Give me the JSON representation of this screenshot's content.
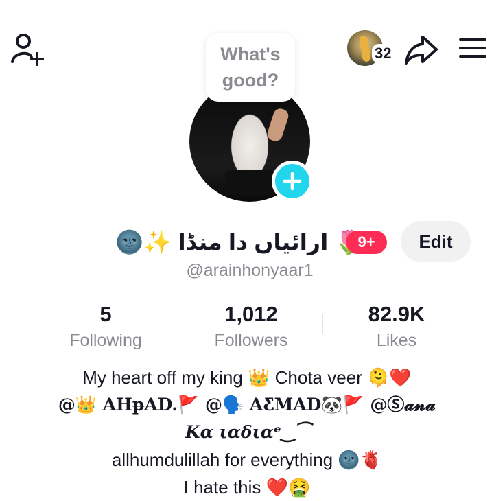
{
  "header": {
    "icons": {
      "add_friend": "person-add-icon",
      "share": "share-arrow-icon",
      "menu": "hamburger-menu-icon"
    },
    "story_count": "32"
  },
  "status_bubble": {
    "text": "What's good?"
  },
  "profile": {
    "display_name": "🌚✨ ارائیاں دا منڈا 🌷",
    "notification_badge": "9+",
    "edit_label": "Edit",
    "handle": "@arainhonyaar1"
  },
  "stats": [
    {
      "value": "5",
      "label": "Following"
    },
    {
      "value": "1,012",
      "label": "Followers"
    },
    {
      "value": "82.9K",
      "label": "Likes"
    }
  ],
  "bio": [
    "My heart off my king 👑 Chota veer 🫠❤️",
    "@👑 AHᵽAD.🚩 @🗣️ AƸMAD🐼🚩 @Ⓢ𝓪𝓷𝓪",
    "𝑲𝜶 𝜾𝜶𝜹𝜾𝜶ᵉ‿⁀",
    "allhumdulillah for everything 🌚🫀",
    "I hate this ❤️🤮"
  ],
  "colors": {
    "accent_cyan": "#20d5ec",
    "badge_red": "#fe2c55",
    "secondary_text": "#8a8b91",
    "edit_bg": "#f1f1f2"
  }
}
